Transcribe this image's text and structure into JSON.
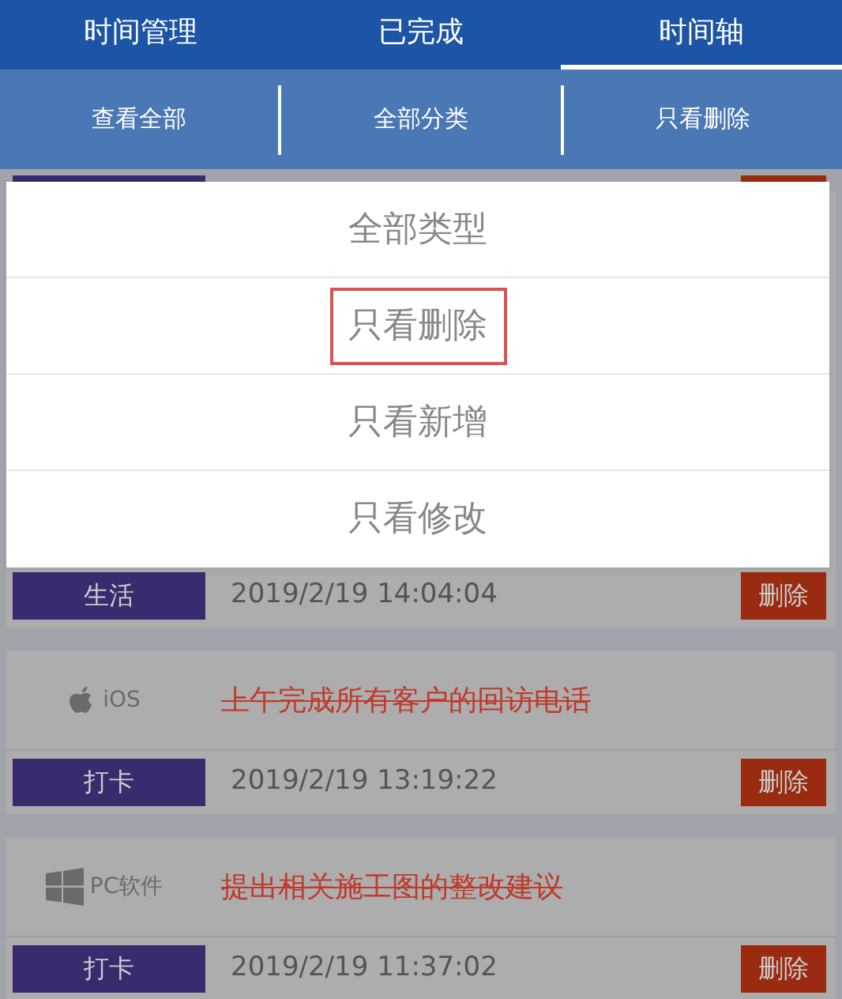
{
  "tabs": [
    {
      "label": "时间管理",
      "selected": false
    },
    {
      "label": "已完成",
      "selected": false
    },
    {
      "label": "时间轴",
      "selected": true
    }
  ],
  "filters": [
    "查看全部",
    "全部分类",
    "只看删除"
  ],
  "dropdown": {
    "options": [
      {
        "label": "全部类型",
        "selected": false
      },
      {
        "label": "只看删除",
        "selected": true
      },
      {
        "label": "只看新增",
        "selected": false
      },
      {
        "label": "只看修改",
        "selected": false
      }
    ]
  },
  "entries": [
    {
      "category": "生活",
      "time": "2019/2/19 14:04:04",
      "action": "删除"
    },
    {
      "platform": {
        "kind": "apple",
        "label": "iOS"
      },
      "title": "上午完成所有客户的回访电话",
      "struck": true,
      "category": "打卡",
      "time": "2019/2/19 13:19:22",
      "action": "删除"
    },
    {
      "platform": {
        "kind": "windows",
        "label": "PC软件"
      },
      "title": "提出相关施工图的整改建议",
      "struck": true,
      "category": "打卡",
      "time": "2019/2/19 11:37:02",
      "action": "删除"
    }
  ]
}
